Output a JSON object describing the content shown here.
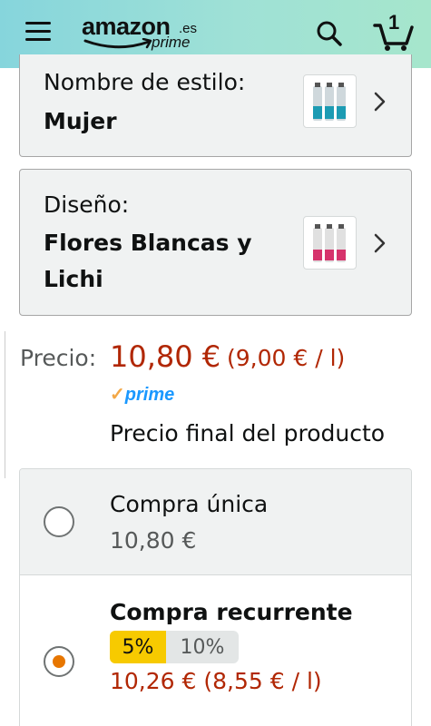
{
  "header": {
    "logo_main": "amazon",
    "logo_tld": ".es",
    "logo_sub": "prime",
    "cart_count": "1",
    "icons": [
      "menu-icon",
      "search-icon",
      "cart-icon"
    ]
  },
  "style": {
    "label": "Nombre de estilo:",
    "value": "Mujer"
  },
  "design": {
    "label": "Diseño:",
    "value": "Flores Blancas y Lichi"
  },
  "price": {
    "label": "Precio:",
    "main": "10,80 €",
    "unit": "(9,00 € / l)",
    "prime_check": "✓",
    "prime": "prime",
    "final_note": "Precio final del producto"
  },
  "purchase_options": {
    "one_time": {
      "title": "Compra única",
      "price": "10,80 €",
      "selected": false
    },
    "recurring": {
      "title": "Compra recurrente",
      "discount_selected": "5%",
      "discount_other": "10%",
      "price": "10,26 € (8,55 € / l)",
      "selected": true
    }
  },
  "colors": {
    "header_gradient_start": "#86d5dc",
    "header_gradient_end": "#a6e6cc",
    "price_red": "#b12704",
    "prime_blue": "#1a98ff",
    "radio_orange": "#e77600",
    "discount_yellow": "#f7ca00"
  }
}
